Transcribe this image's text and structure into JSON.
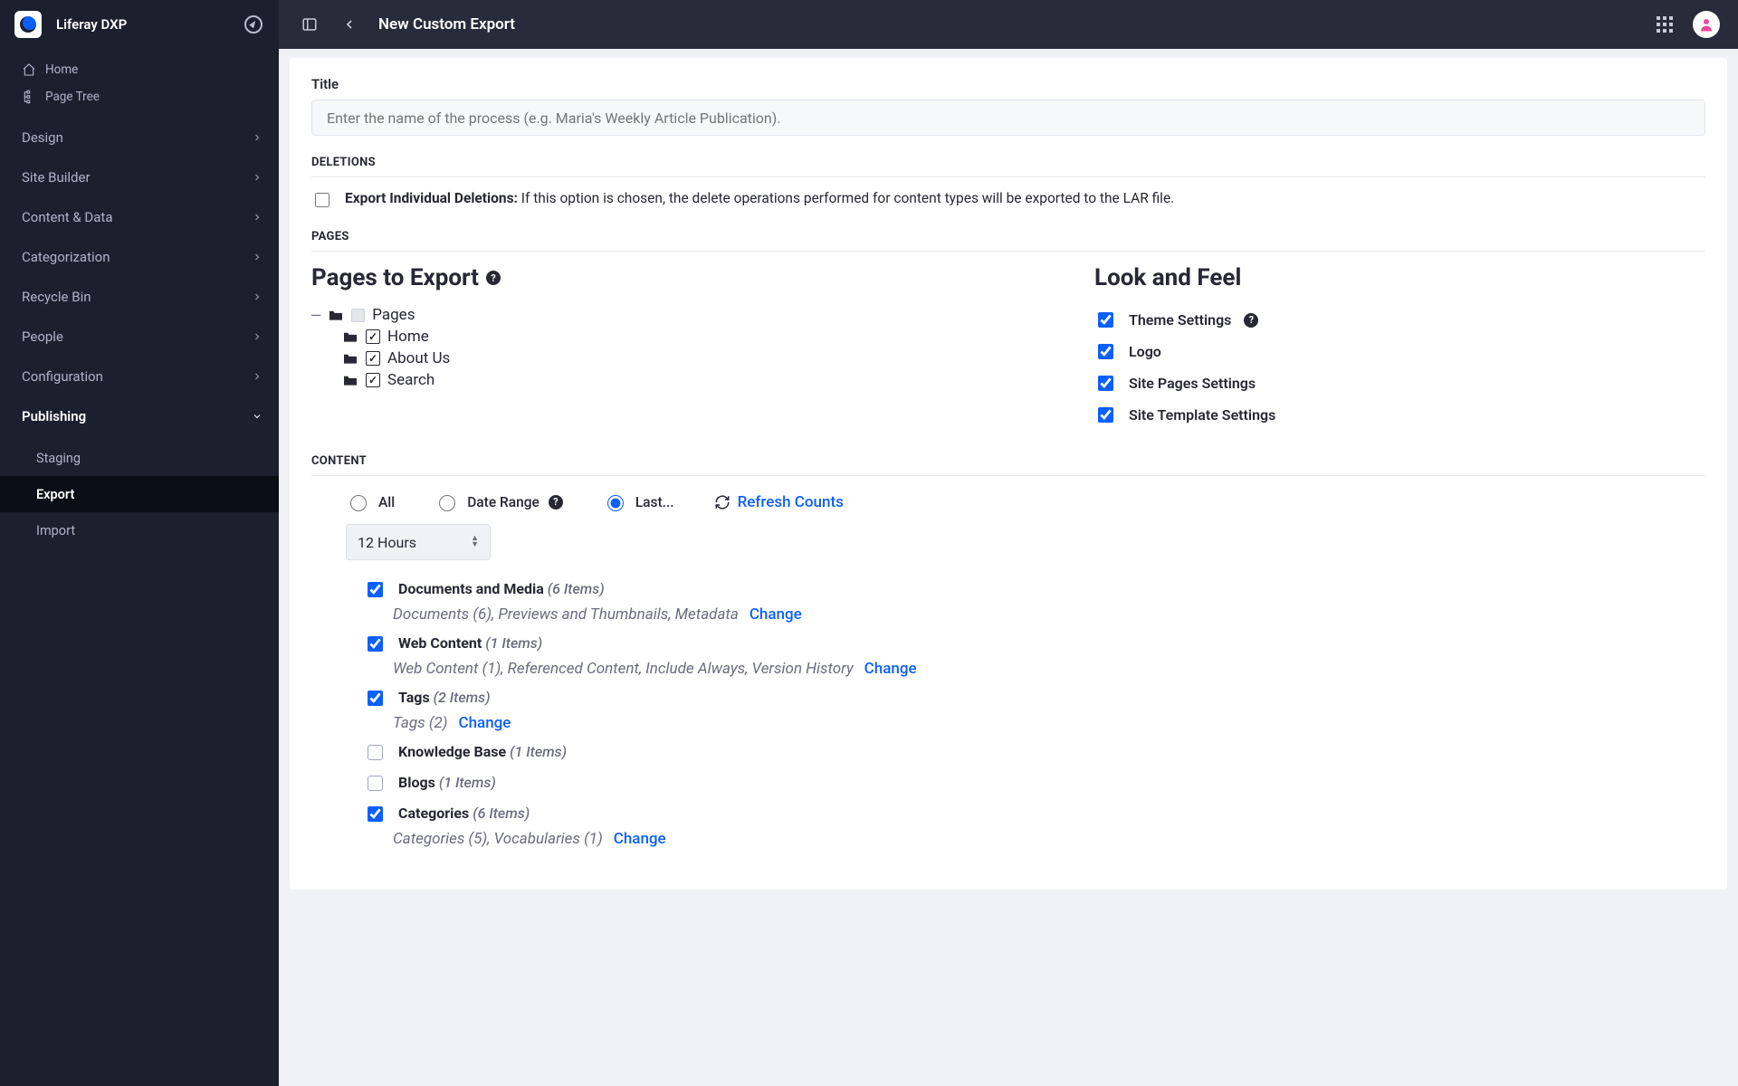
{
  "brand": "Liferay DXP",
  "sidebar": {
    "home": "Home",
    "pageTree": "Page Tree",
    "sections": [
      "Design",
      "Site Builder",
      "Content & Data",
      "Categorization",
      "Recycle Bin",
      "People",
      "Configuration"
    ],
    "publishing": {
      "label": "Publishing",
      "items": [
        "Staging",
        "Export",
        "Import"
      ],
      "active": "Export"
    }
  },
  "topbar": {
    "title": "New Custom Export"
  },
  "title": {
    "label": "Title",
    "placeholder": "Enter the name of the process (e.g. Maria's Weekly Article Publication)."
  },
  "sections": {
    "deletions": "DELETIONS",
    "pages": "PAGES",
    "content": "CONTENT"
  },
  "deletions": {
    "label": "Export Individual Deletions:",
    "desc": "If this option is chosen, the delete operations performed for content types will be exported to the LAR file."
  },
  "pages": {
    "heading": "Pages to Export",
    "rootLabel": "Pages",
    "items": [
      "Home",
      "About Us",
      "Search"
    ]
  },
  "lookFeel": {
    "heading": "Look and Feel",
    "items": [
      {
        "label": "Theme Settings",
        "help": true,
        "checked": true
      },
      {
        "label": "Logo",
        "checked": true
      },
      {
        "label": "Site Pages Settings",
        "checked": true
      },
      {
        "label": "Site Template Settings",
        "checked": true
      }
    ]
  },
  "content": {
    "filters": {
      "all": "All",
      "dateRange": "Date Range",
      "last": "Last...",
      "refresh": "Refresh Counts",
      "selected": "last"
    },
    "lastValue": "12 Hours",
    "items": [
      {
        "name": "Documents and Media",
        "count": "(6 Items)",
        "detail": "Documents (6), Previews and Thumbnails, Metadata",
        "checked": true,
        "change": true
      },
      {
        "name": "Web Content",
        "count": "(1 Items)",
        "detail": "Web Content (1), Referenced Content, Include Always, Version History",
        "checked": true,
        "change": true
      },
      {
        "name": "Tags",
        "count": "(2 Items)",
        "detail": "Tags (2)",
        "checked": true,
        "change": true
      },
      {
        "name": "Knowledge Base",
        "count": "(1 Items)",
        "checked": false
      },
      {
        "name": "Blogs",
        "count": "(1 Items)",
        "checked": false
      },
      {
        "name": "Categories",
        "count": "(6 Items)",
        "detail": "Categories (5), Vocabularies (1)",
        "checked": true,
        "change": true
      }
    ],
    "changeLabel": "Change"
  }
}
